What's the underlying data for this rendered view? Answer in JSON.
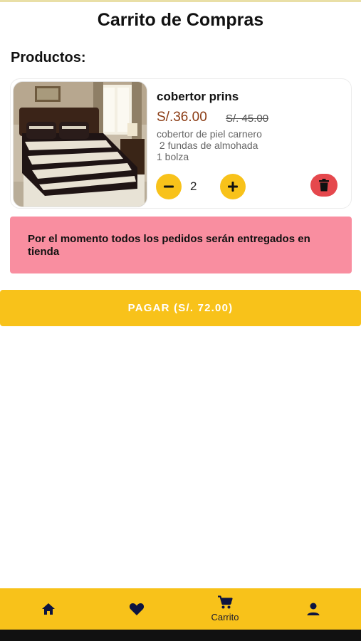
{
  "header": {
    "title": "Carrito de Compras"
  },
  "cart": {
    "section_label": "Productos:",
    "items": [
      {
        "name": "cobertor prins",
        "price": "S/.36.00",
        "old_price": "S/. 45.00",
        "description_lines": [
          "cobertor de piel carnero",
          " 2 fundas de almohada",
          "1 bolza"
        ],
        "quantity": "2",
        "image_icon": "bedspread-photo"
      }
    ]
  },
  "notice": {
    "text": "Por el momento todos los pedidos serán entregados en tienda"
  },
  "checkout": {
    "pay_label": "PAGAR (S/. 72.00)"
  },
  "bottom_nav": {
    "items": [
      {
        "icon": "home-icon",
        "label": ""
      },
      {
        "icon": "heart-icon",
        "label": ""
      },
      {
        "icon": "cart-icon",
        "label": "Carrito"
      },
      {
        "icon": "person-icon",
        "label": ""
      }
    ]
  },
  "colors": {
    "accent": "#f8c21a",
    "notice_bg": "#f98ea0",
    "price": "#8a3a12",
    "delete": "#e5484d",
    "nav_icon": "#0d1440"
  }
}
